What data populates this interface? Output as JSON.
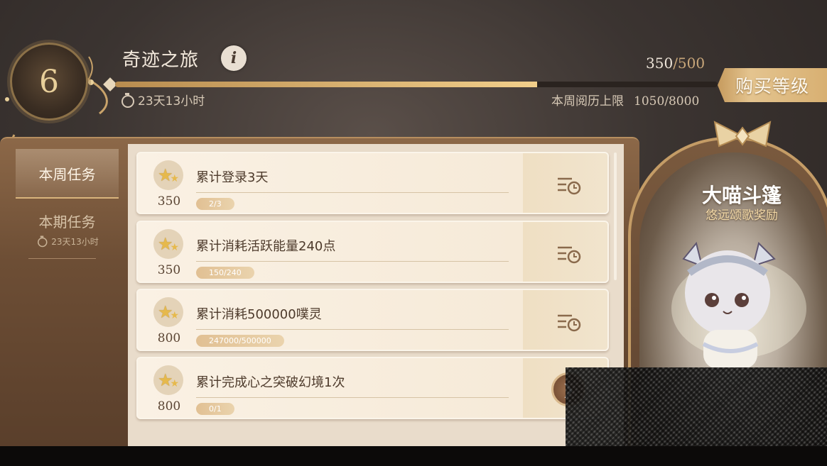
{
  "header": {
    "level": "6",
    "title": "奇迹之旅",
    "info_icon": "info-icon",
    "progress_current": "350",
    "progress_separator": "/500",
    "progress_fraction": 0.7,
    "timer": "23天13小时",
    "weekly_cap_label": "本周阅历上限",
    "weekly_cap_value": "1050/8000",
    "buy_button": "购买等级"
  },
  "sidebar": {
    "tabs": [
      {
        "label": "本周任务",
        "selected": true
      },
      {
        "label": "本期任务",
        "timer": "23天13小时",
        "selected": false
      }
    ]
  },
  "tasks": [
    {
      "name": "累计登录3天",
      "points": "350",
      "progress": "2/3",
      "action": "history-icon"
    },
    {
      "name": "累计消耗活跃能量240点",
      "points": "350",
      "progress": "150/240",
      "action": "history-icon"
    },
    {
      "name": "累计消耗500000噗灵",
      "points": "800",
      "progress": "247000/500000",
      "action": "history-icon"
    },
    {
      "name": "累计完成心之突破幻境1次",
      "points": "800",
      "progress": "0/1",
      "action": "go-arrow-icon"
    }
  ],
  "reward": {
    "name": "大喵斗篷",
    "subtitle": "悠远颂歌奖励"
  },
  "colors": {
    "accent_gold": "#e4c48f",
    "panel_brown": "#6d4e35",
    "card_cream": "#faf1e4"
  }
}
